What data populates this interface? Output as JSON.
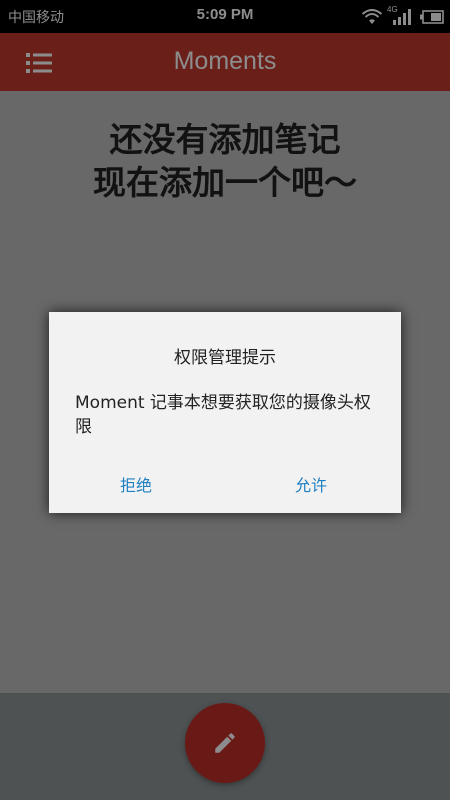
{
  "status_bar": {
    "carrier": "中国移动",
    "time": "5:09 PM",
    "network_label": "4G",
    "icons": [
      "wifi-icon",
      "signal-icon",
      "battery-icon"
    ]
  },
  "app_bar": {
    "title": "Moments",
    "menu_icon": "list-icon",
    "color": "#c23a2f"
  },
  "main": {
    "empty_line1": "还没有添加笔记",
    "empty_line2": "现在添加一个吧～"
  },
  "fab": {
    "icon": "pencil-icon",
    "color": "#c13128"
  },
  "dialog": {
    "title": "权限管理提示",
    "message": "Moment 记事本想要获取您的摄像头权限",
    "deny_label": "拒绝",
    "allow_label": "允许",
    "button_color": "#1e7fc2"
  }
}
